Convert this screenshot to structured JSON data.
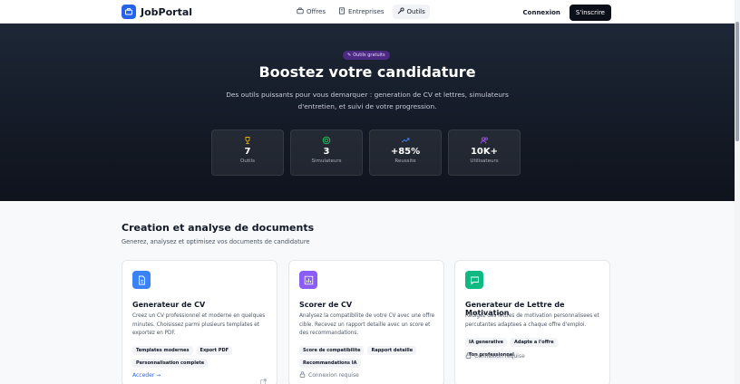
{
  "header": {
    "brand": "JobPortal",
    "nav": [
      {
        "label": "Offres",
        "icon": "briefcase-icon",
        "active": false
      },
      {
        "label": "Entreprises",
        "icon": "building-icon",
        "active": false
      },
      {
        "label": "Outils",
        "icon": "wrench-icon",
        "active": true
      }
    ],
    "login": "Connexion",
    "signup": "S'inscrire"
  },
  "hero": {
    "badge": "Outils gratuits",
    "title": "Boostez votre candidature",
    "subtitle": "Des outils puissants pour vous demarquer : generation de CV et lettres, simulateurs d'entretien, et suivi de votre progression.",
    "stats": [
      {
        "value": "7",
        "label": "Outils",
        "icon": "trophy-icon",
        "color": "#eab308"
      },
      {
        "value": "3",
        "label": "Simulateurs",
        "icon": "target-icon",
        "color": "#22c55e"
      },
      {
        "value": "+85%",
        "label": "Reussite",
        "icon": "trending-up-icon",
        "color": "#3b82f6"
      },
      {
        "value": "10K+",
        "label": "Utilisateurs",
        "icon": "users-icon",
        "color": "#a855f7"
      }
    ]
  },
  "section": {
    "title": "Creation et analyse de documents",
    "subtitle": "Generez, analysez et optimisez vos documents de candidature"
  },
  "cards": [
    {
      "title": "Generateur de CV",
      "description": "Creez un CV professionnel et moderne en quelques minutes. Choisissez parmi plusieurs templates et exportez en PDF.",
      "tags": [
        "Templates modernes",
        "Export PDF",
        "Personnalisation complete"
      ],
      "footer": "Acceder →",
      "icon": "document-icon",
      "color": "#3b82f6"
    },
    {
      "title": "Scorer de CV",
      "description": "Analysez la compatibilite de votre CV avec une offre cible. Recevez un rapport detaille avec un score et des recommandations.",
      "tags": [
        "Score de compatibilite",
        "Rapport detaille",
        "Recommandations IA"
      ],
      "footer": "Connexion requise",
      "icon": "bar-chart-icon",
      "color": "#8b5cf6"
    },
    {
      "title": "Generateur de Lettre de Motivation",
      "description": "Redigez des lettres de motivation personnalisees et percutantes adaptees a chaque offre d'emploi.",
      "tags": [
        "IA generative",
        "Adapte a l'offre",
        "Ton professionnel"
      ],
      "footer": "Connexion requise",
      "icon": "message-icon",
      "color": "#10b981"
    }
  ]
}
